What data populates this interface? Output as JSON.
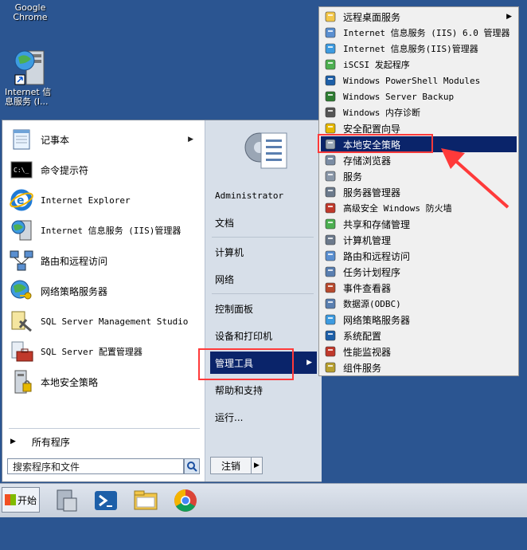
{
  "desktop": {
    "icons": [
      {
        "label": "Google\nChrome"
      },
      {
        "label": "Internet 信\n息服务 (I..."
      }
    ]
  },
  "start_menu": {
    "programs": [
      {
        "label": "记事本",
        "icon": "notepad-icon",
        "has_submenu": true
      },
      {
        "label": "命令提示符",
        "icon": "cmd-icon"
      },
      {
        "label": "Internet Explorer",
        "icon": "ie-icon"
      },
      {
        "label": "Internet 信息服务 (IIS)管理器",
        "icon": "iis-icon"
      },
      {
        "label": "路由和远程访问",
        "icon": "network-icon"
      },
      {
        "label": "网络策略服务器",
        "icon": "globe-key-icon"
      },
      {
        "label": "SQL Server Management Studio",
        "icon": "sql-icon"
      },
      {
        "label": "SQL Server 配置管理器",
        "icon": "toolbox-icon"
      },
      {
        "label": "本地安全策略",
        "icon": "security-policy-icon"
      }
    ],
    "all_programs": "所有程序",
    "search_placeholder": "搜索程序和文件",
    "right": {
      "user": "Administrator",
      "items": [
        "文档",
        "计算机",
        "网络",
        "控制面板",
        "设备和打印机",
        "管理工具",
        "帮助和支持",
        "运行..."
      ],
      "shutdown": "注销"
    }
  },
  "admin_tools_submenu": [
    "远程桌面服务",
    "Internet 信息服务 (IIS) 6.0 管理器",
    "Internet 信息服务(IIS)管理器",
    "iSCSI 发起程序",
    "Windows PowerShell Modules",
    "Windows Server Backup",
    "Windows 内存诊断",
    "安全配置向导",
    "本地安全策略",
    "存储浏览器",
    "服务",
    "服务器管理器",
    "高级安全 Windows 防火墙",
    "共享和存储管理",
    "计算机管理",
    "路由和远程访问",
    "任务计划程序",
    "事件查看器",
    "数据源(ODBC)",
    "网络策略服务器",
    "系统配置",
    "性能监视器",
    "组件服务"
  ],
  "taskbar": {
    "start_label": "开始"
  },
  "colors": {
    "desktop": "#2b5591",
    "selection": "#0a246a",
    "highlight": "#ff3a3a"
  }
}
